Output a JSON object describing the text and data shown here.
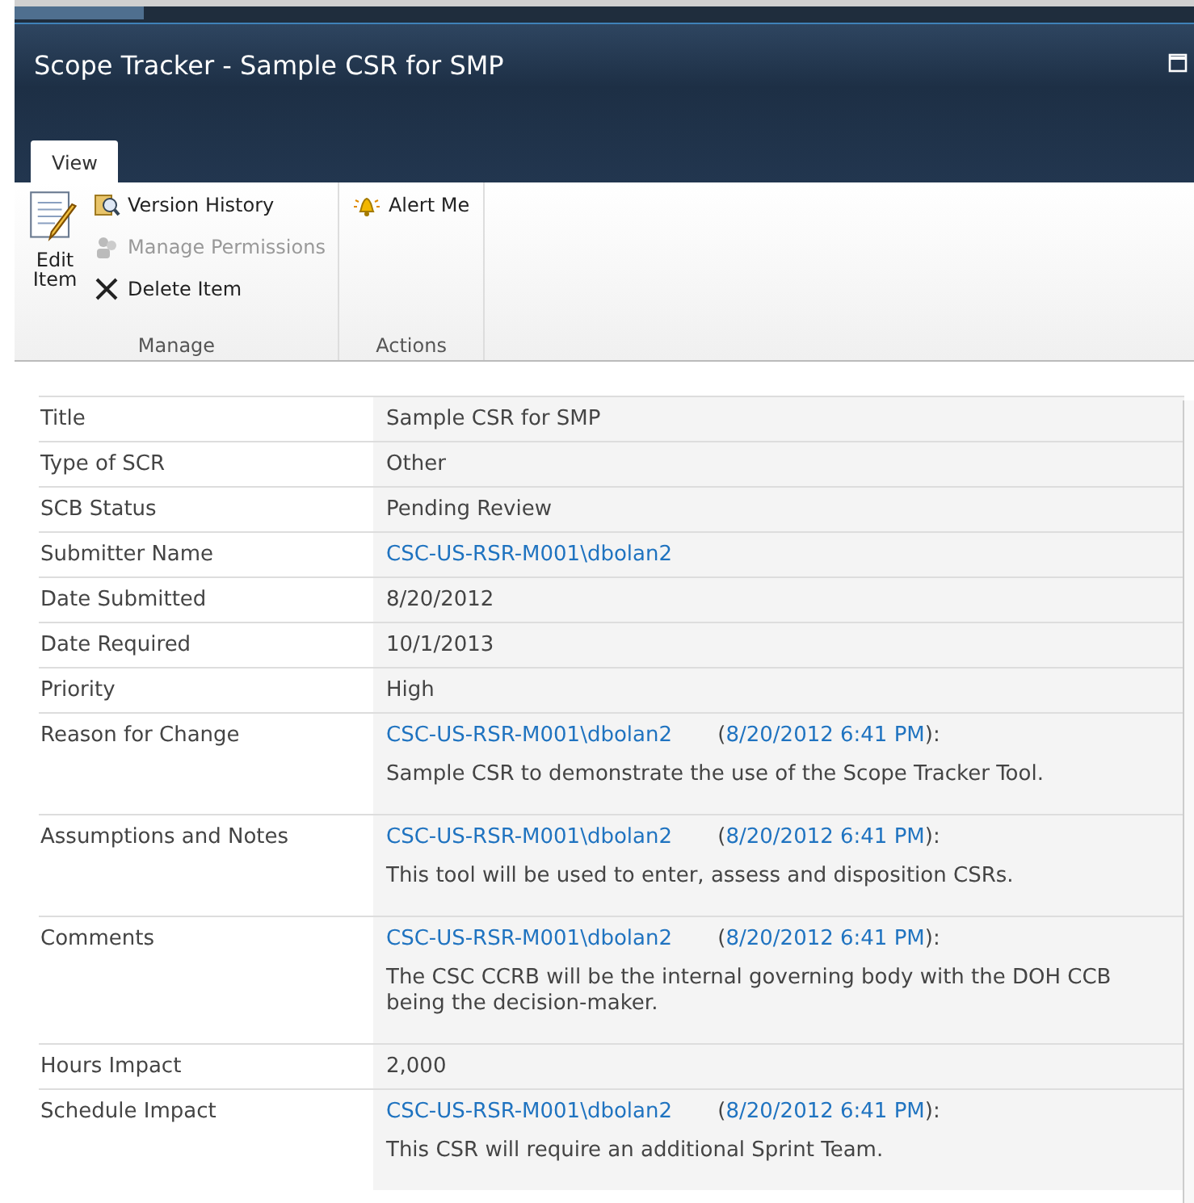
{
  "window": {
    "title": "Scope Tracker - Sample CSR for SMP"
  },
  "tabs": [
    {
      "label": "View",
      "selected": true
    }
  ],
  "ribbon": {
    "groups": [
      {
        "label": "Manage",
        "large": {
          "label_lines": [
            "Edit",
            "Item"
          ],
          "kind": "edit",
          "disabled": false
        },
        "items": [
          {
            "label": "Version History",
            "kind": "history",
            "disabled": false
          },
          {
            "label": "Manage Permissions",
            "kind": "permissions",
            "disabled": true
          },
          {
            "label": "Delete Item",
            "kind": "delete",
            "disabled": false
          }
        ]
      },
      {
        "label": "Actions",
        "items": [
          {
            "label": "Alert Me",
            "kind": "alert",
            "disabled": false
          }
        ]
      }
    ]
  },
  "fields": [
    {
      "label": "Title",
      "kind": "text",
      "value": "Sample CSR for SMP"
    },
    {
      "label": "Type of SCR",
      "kind": "text",
      "value": "Other"
    },
    {
      "label": "SCB Status",
      "kind": "text",
      "value": "Pending Review"
    },
    {
      "label": "Submitter Name",
      "kind": "link",
      "value": "CSC-US-RSR-M001\\dbolan2"
    },
    {
      "label": "Date Submitted",
      "kind": "text",
      "value": "8/20/2012"
    },
    {
      "label": "Date Required",
      "kind": "text",
      "value": "10/1/2013"
    },
    {
      "label": "Priority",
      "kind": "text",
      "value": "High"
    },
    {
      "label": "Reason for Change",
      "kind": "entry",
      "author": "CSC-US-RSR-M001\\dbolan2",
      "open": "(",
      "date": "8/20/2012 6:41 PM",
      "close": "):",
      "text": "Sample CSR to demonstrate the use of the Scope Tracker Tool."
    },
    {
      "label": "Assumptions and Notes",
      "kind": "entry",
      "author": "CSC-US-RSR-M001\\dbolan2",
      "open": "(",
      "date": "8/20/2012 6:41 PM",
      "close": "):",
      "text": "This tool will be used to enter, assess and disposition CSRs."
    },
    {
      "label": "Comments",
      "kind": "entry",
      "author": "CSC-US-RSR-M001\\dbolan2",
      "open": "(",
      "date": "8/20/2012 6:41 PM",
      "close": "):",
      "text": "The CSC CCRB will be the internal governing body with the DOH CCB being the decision-maker."
    },
    {
      "label": "Hours Impact",
      "kind": "text",
      "value": "2,000"
    },
    {
      "label": "Schedule Impact",
      "kind": "entry",
      "author": "CSC-US-RSR-M001\\dbolan2",
      "open": "(",
      "date": "8/20/2012 6:41 PM",
      "close": "):",
      "text": "This CSR will require an additional Sprint Team."
    }
  ]
}
